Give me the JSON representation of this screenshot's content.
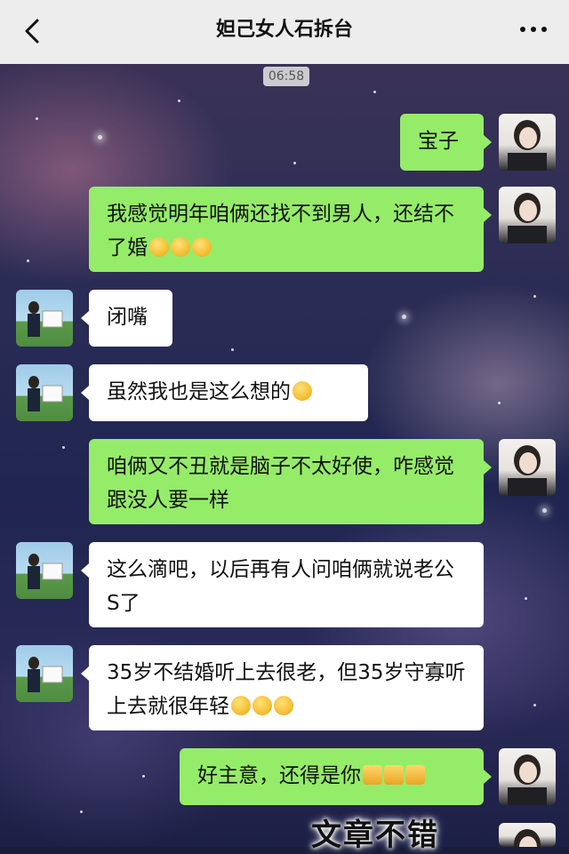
{
  "header": {
    "title": "妲己女人石拆台"
  },
  "chat": {
    "time": "06:58",
    "messages": [
      {
        "side": "me",
        "text": "宝子",
        "emojis": ""
      },
      {
        "side": "me",
        "text": "我感觉明年咱俩还找不到男人，还结不了婚",
        "emojis": "😳😳😳"
      },
      {
        "side": "other",
        "text": "闭嘴",
        "emojis": ""
      },
      {
        "side": "other",
        "text": "虽然我也是这么想的",
        "emojis": "🤣"
      },
      {
        "side": "me",
        "text": "咱俩又不丑就是脑子不太好使，咋感觉跟没人要一样",
        "emojis": ""
      },
      {
        "side": "other",
        "text": "这么滴吧，以后再有人问咱俩就说老公S了",
        "emojis": ""
      },
      {
        "side": "other",
        "text": "35岁不结婚听上去很老，但35岁守寡听上去就很年轻",
        "emojis": "🤭🤭🤭"
      },
      {
        "side": "me",
        "text": "好主意，还得是你",
        "emojis": "👍👍👍"
      }
    ]
  },
  "overlay": {
    "caption": "文章不错"
  },
  "colors": {
    "my_bubble": "#95ec69",
    "their_bubble": "#ffffff",
    "topbar": "#ededed"
  }
}
